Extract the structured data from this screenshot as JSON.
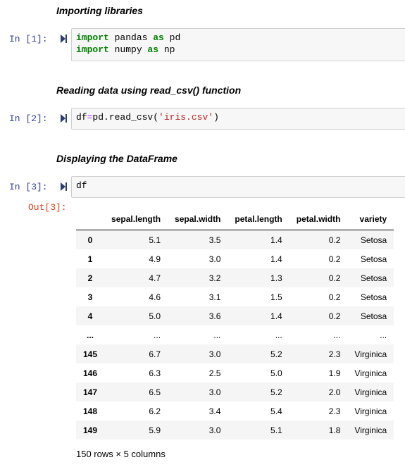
{
  "cells": [
    {
      "heading": "Importing libraries",
      "prompt": "In [1]:",
      "lines": [
        [
          {
            "t": "import",
            "c": "kw"
          },
          {
            "t": " pandas ",
            "c": ""
          },
          {
            "t": "as",
            "c": "kw"
          },
          {
            "t": " pd",
            "c": ""
          }
        ],
        [
          {
            "t": "import",
            "c": "kw"
          },
          {
            "t": " numpy ",
            "c": ""
          },
          {
            "t": "as",
            "c": "kw"
          },
          {
            "t": " np",
            "c": ""
          }
        ]
      ]
    },
    {
      "heading": "Reading data using read_csv() function",
      "prompt": "In [2]:",
      "lines": [
        [
          {
            "t": "df",
            "c": ""
          },
          {
            "t": "=",
            "c": "op"
          },
          {
            "t": "pd.read_csv(",
            "c": ""
          },
          {
            "t": "'iris.csv'",
            "c": "str"
          },
          {
            "t": ")",
            "c": ""
          }
        ]
      ]
    },
    {
      "heading": "Displaying the DataFrame",
      "prompt": "In [3]:",
      "lines": [
        [
          {
            "t": "df",
            "c": ""
          }
        ]
      ]
    }
  ],
  "output": {
    "prompt": "Out[3]:",
    "columns": [
      "",
      "sepal.length",
      "sepal.width",
      "petal.length",
      "petal.width",
      "variety"
    ],
    "rows": [
      [
        "0",
        "5.1",
        "3.5",
        "1.4",
        "0.2",
        "Setosa"
      ],
      [
        "1",
        "4.9",
        "3.0",
        "1.4",
        "0.2",
        "Setosa"
      ],
      [
        "2",
        "4.7",
        "3.2",
        "1.3",
        "0.2",
        "Setosa"
      ],
      [
        "3",
        "4.6",
        "3.1",
        "1.5",
        "0.2",
        "Setosa"
      ],
      [
        "4",
        "5.0",
        "3.6",
        "1.4",
        "0.2",
        "Setosa"
      ],
      [
        "...",
        "...",
        "...",
        "...",
        "...",
        "..."
      ],
      [
        "145",
        "6.7",
        "3.0",
        "5.2",
        "2.3",
        "Virginica"
      ],
      [
        "146",
        "6.3",
        "2.5",
        "5.0",
        "1.9",
        "Virginica"
      ],
      [
        "147",
        "6.5",
        "3.0",
        "5.2",
        "2.0",
        "Virginica"
      ],
      [
        "148",
        "6.2",
        "3.4",
        "5.4",
        "2.3",
        "Virginica"
      ],
      [
        "149",
        "5.9",
        "3.0",
        "5.1",
        "1.8",
        "Virginica"
      ]
    ],
    "shape_text": "150 rows × 5 columns"
  },
  "icons": {
    "run": "run-cell-icon"
  },
  "colors": {
    "prompt_in": "#303f9f",
    "prompt_out": "#d84315",
    "keyword": "#008000",
    "string": "#ba2121",
    "operator": "#aa22ff",
    "run_icon": "#2c3e70"
  }
}
